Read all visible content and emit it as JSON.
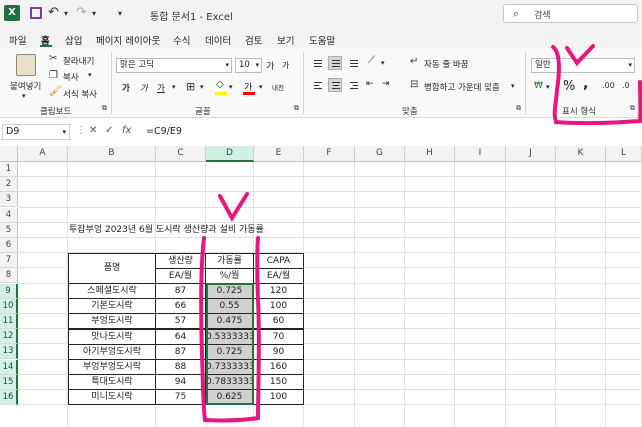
{
  "titlebar": {
    "app_icon": "X",
    "doc_title": "통합 문서1  -  Excel",
    "search_placeholder": "검색",
    "undo_glyph": "↶",
    "redo_glyph": "↷",
    "dropdown_glyph": "▾"
  },
  "menu": {
    "tabs": [
      "파일",
      "홈",
      "삽입",
      "페이지 레이아웃",
      "수식",
      "데이터",
      "검토",
      "보기",
      "도움말"
    ],
    "active": "홈"
  },
  "ribbon": {
    "clipboard": {
      "paste": "붙여넣기",
      "cut": "잘라내기",
      "copy": "복사",
      "format_painter": "서식 복사",
      "label": "클립보드"
    },
    "font": {
      "name": "맑은 고딕",
      "size": "10",
      "label": "글꼴",
      "bold": "가",
      "italic": "가",
      "underline": "가",
      "font_color_glyph": "가",
      "phonetic": "내천",
      "grow": "가",
      "shrink": "가"
    },
    "alignment": {
      "wrap": "자동 줄 바꿈",
      "merge": "병합하고 가운데 맞춤",
      "label": "맞춤"
    },
    "number": {
      "format": "일반",
      "percent": "%",
      "comma": ",",
      "label": "표시 형식"
    }
  },
  "formula_bar": {
    "name_box": "D9",
    "fx": "fx",
    "cancel": "✕",
    "enter": "✓",
    "formula": "=C9/E9"
  },
  "grid": {
    "columns": [
      "A",
      "B",
      "C",
      "D",
      "E",
      "F",
      "G",
      "H",
      "I",
      "J",
      "K",
      "L"
    ],
    "rows": [
      "1",
      "2",
      "3",
      "4",
      "5",
      "6",
      "7",
      "8",
      "9",
      "10",
      "11",
      "12",
      "13",
      "14",
      "15",
      "16"
    ],
    "selected_column": "D",
    "selected_rows": [
      "9",
      "10",
      "11",
      "12",
      "13",
      "14",
      "15",
      "16"
    ]
  },
  "table": {
    "title": "투잡부엉 2023년 6월 도시락 생산량과 설비 가동률",
    "header": {
      "product": "품명",
      "production": "생산량",
      "production_unit": "EA/월",
      "utilization": "가동률",
      "utilization_unit": "%/월",
      "capa": "CAPA",
      "capa_unit": "EA/월"
    },
    "rows": [
      {
        "name": "스페셜도시락",
        "prod": "87",
        "util": "0.725",
        "capa": "120"
      },
      {
        "name": "기본도시락",
        "prod": "66",
        "util": "0.55",
        "capa": "100"
      },
      {
        "name": "부엉도시락",
        "prod": "57",
        "util": "0.475",
        "capa": "60"
      },
      {
        "name": "맛나도시락",
        "prod": "64",
        "util": "0.5333333",
        "capa": "70"
      },
      {
        "name": "아기부엉도시락",
        "prod": "87",
        "util": "0.725",
        "capa": "90"
      },
      {
        "name": "부엉부엉도시락",
        "prod": "88",
        "util": "0.7333333",
        "capa": "160"
      },
      {
        "name": "특대도시락",
        "prod": "94",
        "util": "0.7833333",
        "capa": "150"
      },
      {
        "name": "미니도시락",
        "prod": "75",
        "util": "0.625",
        "capa": "100"
      }
    ]
  },
  "colors": {
    "excel_green": "#217346",
    "annotation_magenta": "#e8177f"
  }
}
